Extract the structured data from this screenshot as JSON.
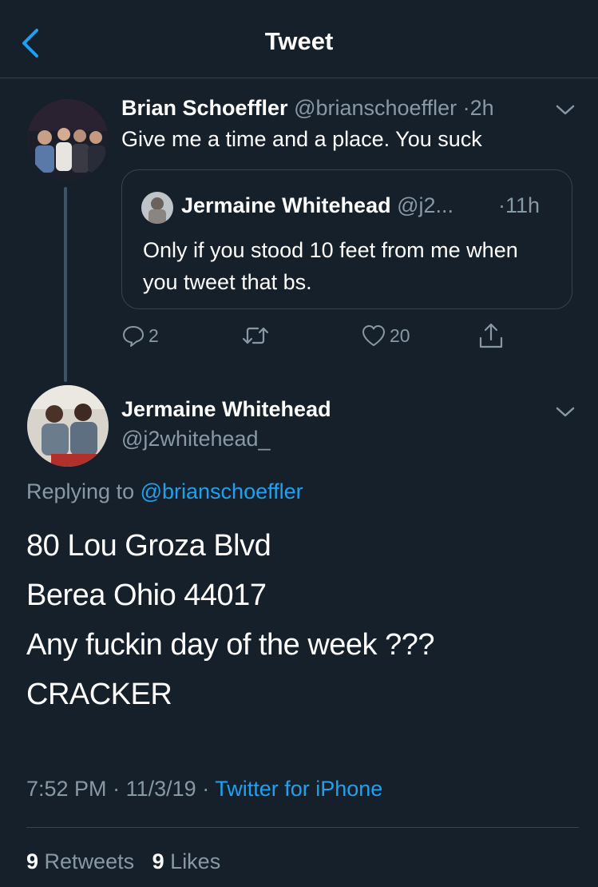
{
  "header": {
    "title": "Tweet"
  },
  "parent_tweet": {
    "author_name": "Brian Schoeffler",
    "author_handle": "@brianschoeffler",
    "time": "2h",
    "separator": "·",
    "text": "Give me a time and a place. You suck",
    "quoted_tweet": {
      "author_name": "Jermaine Whitehead",
      "author_handle": "@j2...",
      "time": "·11h",
      "text": "Only if you stood 10 feet from me when you tweet that bs."
    },
    "actions": {
      "reply_count": "2",
      "retweet_count": "",
      "like_count": "20"
    }
  },
  "main_tweet": {
    "author_name": "Jermaine Whitehead",
    "author_handle": "@j2whitehead_",
    "replying_prefix": "Replying to",
    "replying_to": "@brianschoeffler",
    "lines": [
      "80 Lou Groza Blvd",
      "Berea Ohio 44017",
      "Any fuckin day of the week ???",
      "CRACKER"
    ],
    "time": "7:52 PM",
    "date": "11/3/19",
    "sep": "·",
    "source": "Twitter for iPhone",
    "retweets_count": "9",
    "retweets_label": "Retweets",
    "likes_count": "9",
    "likes_label": "Likes"
  },
  "icons": {
    "back": "chevron-left-icon",
    "more": "chevron-down-icon",
    "reply": "speech-bubble-icon",
    "retweet": "retweet-icon",
    "like": "heart-icon",
    "share": "share-icon"
  },
  "colors": {
    "background": "#15202b",
    "accent": "#1da1f2",
    "muted": "#8899a6",
    "border": "#38444d"
  }
}
